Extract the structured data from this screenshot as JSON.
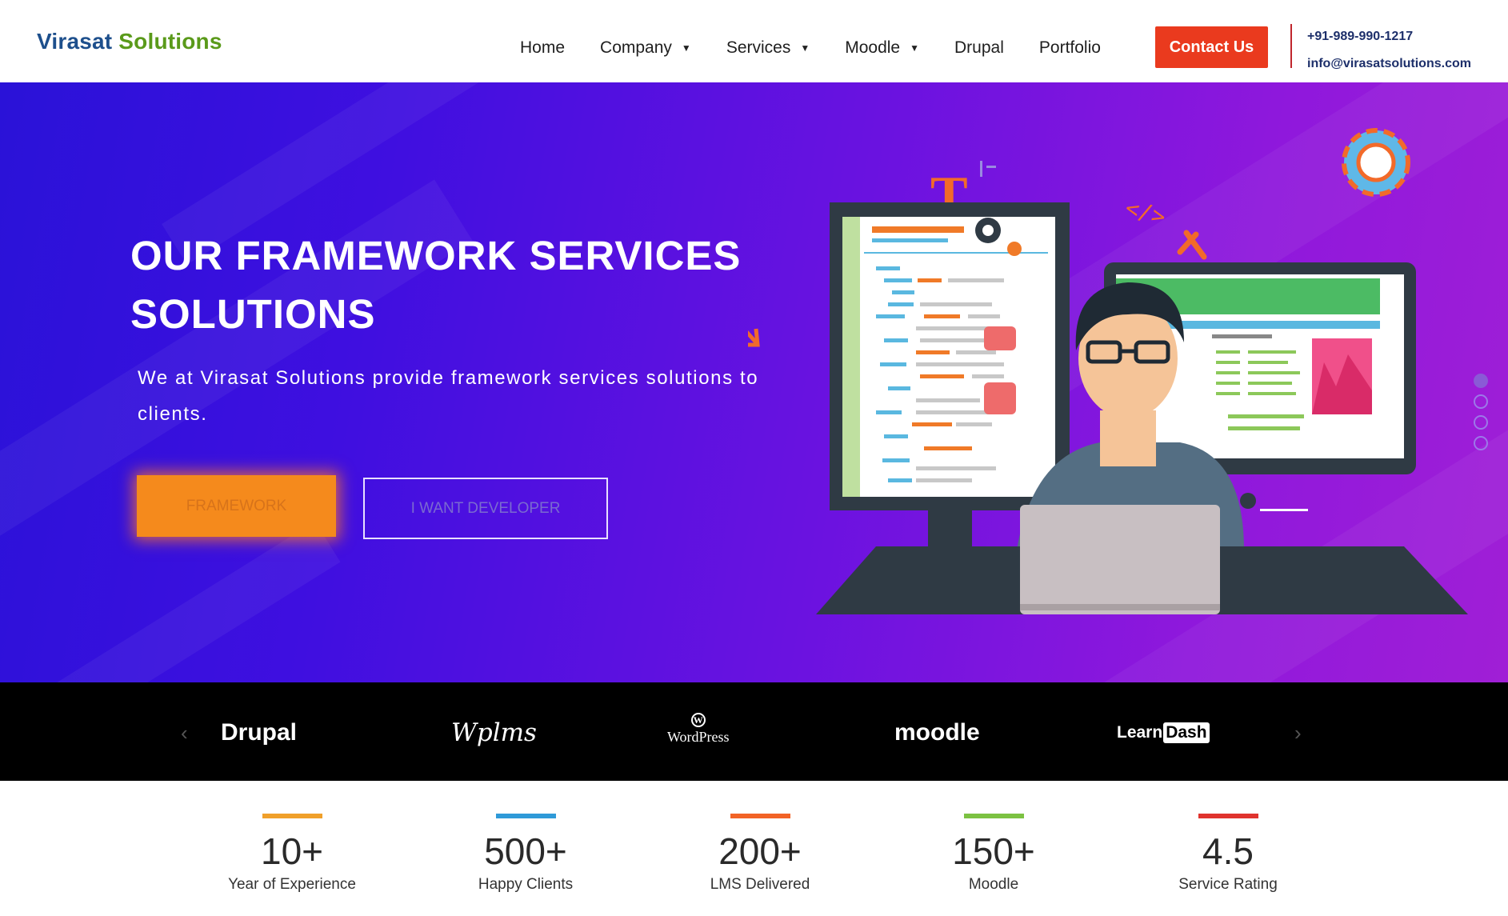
{
  "header": {
    "logo_part1": "Virasat",
    "logo_part2": "Solutions",
    "nav": [
      {
        "label": "Home"
      },
      {
        "label": "Company"
      },
      {
        "label": "Services"
      },
      {
        "label": "Moodle"
      },
      {
        "label": "Drupal"
      },
      {
        "label": "Portfolio"
      }
    ],
    "caret": "▼",
    "contact_label": "Contact Us",
    "phone": "+91-989-990-1217",
    "email": "info@virasatsolutions.com"
  },
  "hero": {
    "title_line1": "OUR FRAMEWORK SERVICES",
    "title_line2": "SOLUTIONS",
    "subtitle": "We at Virasat Solutions provide framework services solutions to clients.",
    "primary_button": "FRAMEWORK",
    "secondary_button": "I WANT DEVELOPER",
    "slides": [
      true,
      false,
      false,
      false
    ]
  },
  "logo_strip": {
    "prev": "‹",
    "next": "›",
    "drupal": "Drupal",
    "wplms": "Wplms",
    "wordpress_mark": "W",
    "wordpress": "WordPress",
    "moodle": "moodle",
    "learndash_a": "Learn",
    "learndash_b": "Dash"
  },
  "stats": [
    {
      "value": "10+",
      "label": "Year of Experience",
      "color": "#f0a02a"
    },
    {
      "value": "500+",
      "label": "Happy Clients",
      "color": "#2f9ad8"
    },
    {
      "value": "200+",
      "label": "LMS Delivered",
      "color": "#f26326"
    },
    {
      "value": "150+",
      "label": "Moodle",
      "color": "#7cc242"
    },
    {
      "value": "4.5",
      "label": "Service Rating",
      "color": "#e0332e"
    }
  ],
  "colors": {
    "brand_blue": "#1d4f8c",
    "brand_green": "#5a9a1a",
    "contact_red": "#ea3a1e",
    "framework_orange": "#f58a1c"
  }
}
